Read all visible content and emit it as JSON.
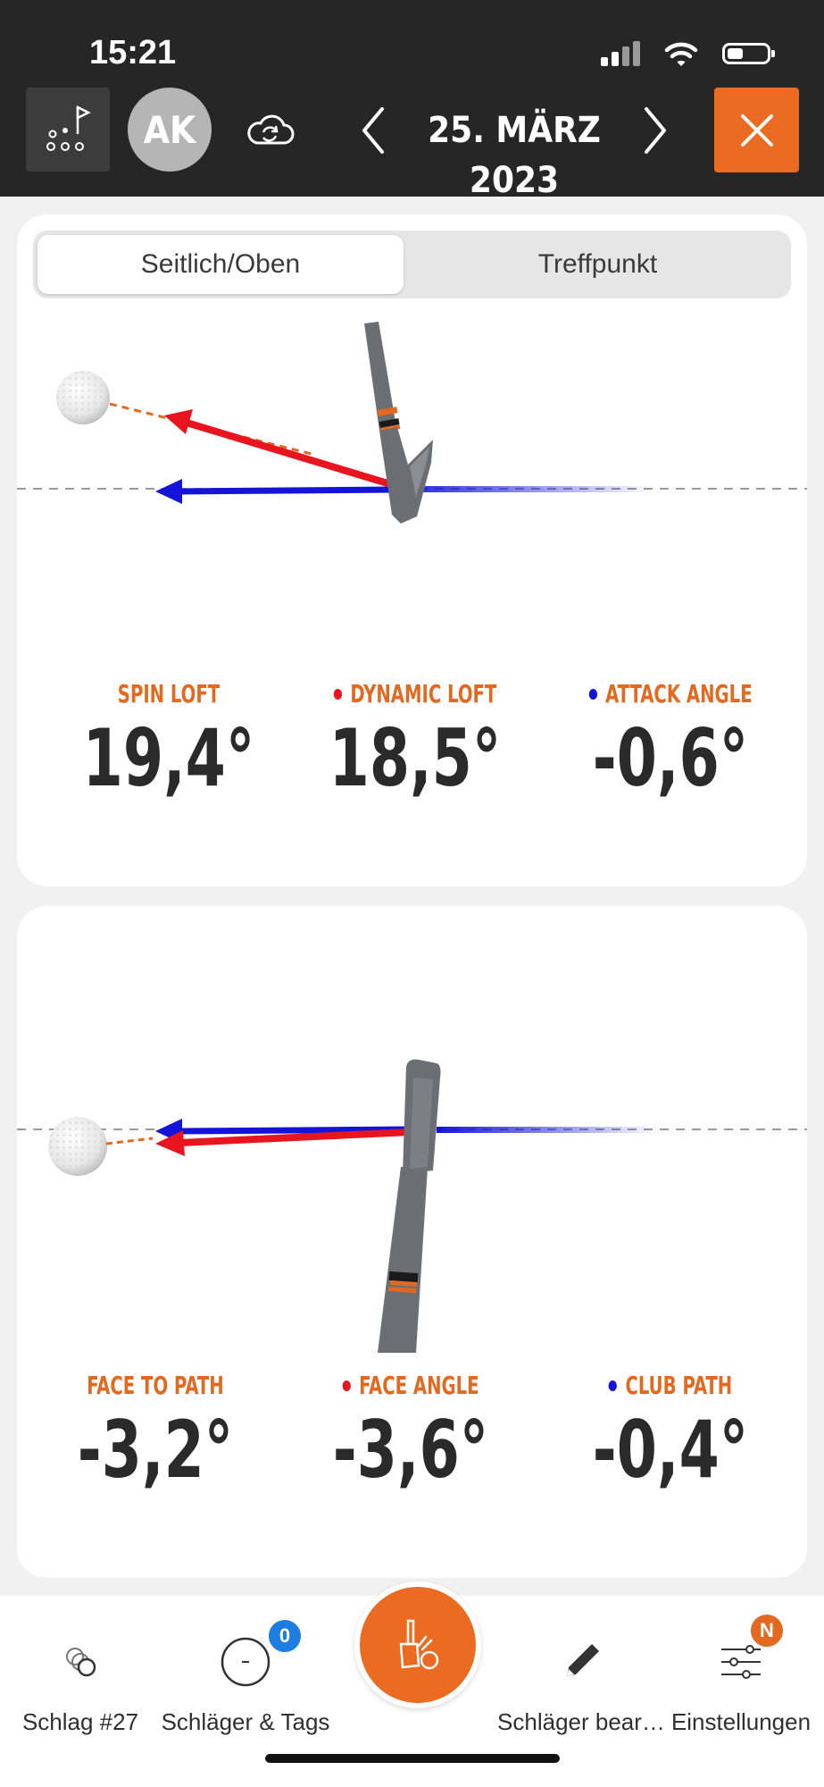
{
  "status_bar": {
    "time": "15:21"
  },
  "header": {
    "avatar_initials": "AK",
    "date": "25. MÄRZ 2023",
    "icons": {
      "course": "golf-flag-icon",
      "sync": "cloud-sync-icon",
      "prev": "chevron-left-icon",
      "next": "chevron-right-icon",
      "close": "close-icon"
    }
  },
  "tabs": {
    "active": "Seitlich/Oben",
    "inactive": "Treffpunkt"
  },
  "side_view": {
    "metrics": [
      {
        "label": "SPIN LOFT",
        "value": "19,4°",
        "dot": ""
      },
      {
        "label": "DYNAMIC LOFT",
        "value": "18,5°",
        "dot": "#e8141e"
      },
      {
        "label": "ATTACK ANGLE",
        "value": "-0,6°",
        "dot": "#1414d8"
      }
    ]
  },
  "top_view": {
    "metrics": [
      {
        "label": "FACE TO PATH",
        "value": "-3,2°",
        "dot": ""
      },
      {
        "label": "FACE ANGLE",
        "value": "-3,6°",
        "dot": "#e8141e"
      },
      {
        "label": "CLUB PATH",
        "value": "-0,4°",
        "dot": "#1414d8"
      }
    ]
  },
  "bottom_bar": {
    "items": [
      {
        "label": "Schlag #27",
        "icon": "shot-circles-icon"
      },
      {
        "label": "Schläger & Tags",
        "icon": "club-tag-icon",
        "badge": "0"
      },
      {
        "label": "Schläger bear…",
        "icon": "pencil-icon"
      },
      {
        "label": "Einstellungen",
        "icon": "sliders-icon",
        "badge": "N"
      }
    ],
    "center_icon": "hand-club-icon"
  },
  "colors": {
    "accent": "#ea6b21",
    "face_red": "#e8141e",
    "path_blue": "#1414d8",
    "header_bg": "#262626"
  }
}
